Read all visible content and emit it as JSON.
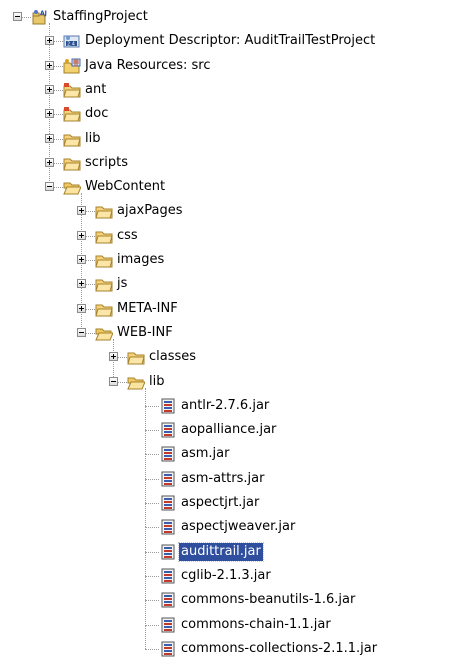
{
  "tree": {
    "nodes": [
      {
        "name": "tree-node-staffingproject",
        "label": "StaffingProject",
        "icon": "project-icon",
        "depth": 0,
        "toggle": "minus"
      },
      {
        "name": "tree-node-deployment-descriptor",
        "label": "Deployment Descriptor: AuditTrailTestProject",
        "icon": "deployment-descriptor-icon",
        "depth": 1,
        "toggle": "plus"
      },
      {
        "name": "tree-node-java-resources",
        "label": "Java Resources: src",
        "icon": "java-resources-icon",
        "depth": 1,
        "toggle": "plus"
      },
      {
        "name": "tree-node-ant",
        "label": "ant",
        "icon": "source-folder-icon",
        "depth": 1,
        "toggle": "plus"
      },
      {
        "name": "tree-node-doc",
        "label": "doc",
        "icon": "source-folder-icon",
        "depth": 1,
        "toggle": "plus"
      },
      {
        "name": "tree-node-lib",
        "label": "lib",
        "icon": "folder-icon",
        "depth": 1,
        "toggle": "plus"
      },
      {
        "name": "tree-node-scripts",
        "label": "scripts",
        "icon": "folder-icon",
        "depth": 1,
        "toggle": "plus"
      },
      {
        "name": "tree-node-webcontent",
        "label": "WebContent",
        "icon": "folder-open-icon",
        "depth": 1,
        "toggle": "minus"
      },
      {
        "name": "tree-node-ajaxpages",
        "label": "ajaxPages",
        "icon": "folder-icon",
        "depth": 2,
        "toggle": "plus"
      },
      {
        "name": "tree-node-css",
        "label": "css",
        "icon": "folder-icon",
        "depth": 2,
        "toggle": "plus"
      },
      {
        "name": "tree-node-images",
        "label": "images",
        "icon": "folder-icon",
        "depth": 2,
        "toggle": "plus"
      },
      {
        "name": "tree-node-js",
        "label": "js",
        "icon": "folder-icon",
        "depth": 2,
        "toggle": "plus"
      },
      {
        "name": "tree-node-meta-inf",
        "label": "META-INF",
        "icon": "folder-icon",
        "depth": 2,
        "toggle": "plus"
      },
      {
        "name": "tree-node-web-inf",
        "label": "WEB-INF",
        "icon": "folder-open-icon",
        "depth": 2,
        "toggle": "minus"
      },
      {
        "name": "tree-node-classes",
        "label": "classes",
        "icon": "folder-icon",
        "depth": 3,
        "toggle": "plus"
      },
      {
        "name": "tree-node-web-inf-lib",
        "label": "lib",
        "icon": "folder-open-icon",
        "depth": 3,
        "toggle": "minus"
      },
      {
        "name": "tree-node-jar",
        "label": "antlr-2.7.6.jar",
        "icon": "jar-icon",
        "depth": 4,
        "toggle": "none"
      },
      {
        "name": "tree-node-jar",
        "label": "aopalliance.jar",
        "icon": "jar-icon",
        "depth": 4,
        "toggle": "none"
      },
      {
        "name": "tree-node-jar",
        "label": "asm.jar",
        "icon": "jar-icon",
        "depth": 4,
        "toggle": "none"
      },
      {
        "name": "tree-node-jar",
        "label": "asm-attrs.jar",
        "icon": "jar-icon",
        "depth": 4,
        "toggle": "none"
      },
      {
        "name": "tree-node-jar",
        "label": "aspectjrt.jar",
        "icon": "jar-icon",
        "depth": 4,
        "toggle": "none"
      },
      {
        "name": "tree-node-jar",
        "label": "aspectjweaver.jar",
        "icon": "jar-icon",
        "depth": 4,
        "toggle": "none"
      },
      {
        "name": "tree-node-jar",
        "label": "audittrail.jar",
        "icon": "jar-icon",
        "depth": 4,
        "toggle": "none",
        "selected": true
      },
      {
        "name": "tree-node-jar",
        "label": "cglib-2.1.3.jar",
        "icon": "jar-icon",
        "depth": 4,
        "toggle": "none"
      },
      {
        "name": "tree-node-jar",
        "label": "commons-beanutils-1.6.jar",
        "icon": "jar-icon",
        "depth": 4,
        "toggle": "none"
      },
      {
        "name": "tree-node-jar",
        "label": "commons-chain-1.1.jar",
        "icon": "jar-icon",
        "depth": 4,
        "toggle": "none"
      },
      {
        "name": "tree-node-jar",
        "label": "commons-collections-2.1.1.jar",
        "icon": "jar-icon",
        "depth": 4,
        "toggle": "none"
      }
    ]
  }
}
